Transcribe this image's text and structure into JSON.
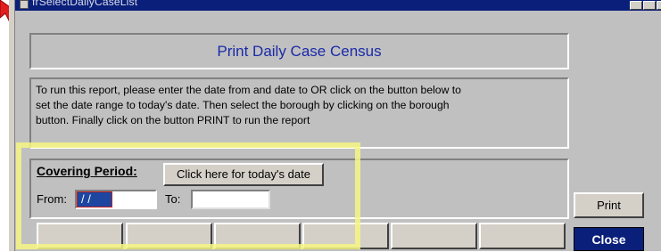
{
  "window": {
    "title": "frSelectDailyCaseList"
  },
  "header": {
    "title": "Print Daily Case Census"
  },
  "instructions": {
    "line1": "To run this report, please enter the date from and date to OR click on the button below to",
    "line2": "set the date range to today's date. Then select the borough by clicking on the borough",
    "line3": "button. Finally click on the button PRINT to run the report"
  },
  "period": {
    "label": "Covering Period:",
    "today_button": "Click here for today's date",
    "from_label": "From:",
    "from_value": " / /",
    "to_label": "To:",
    "to_value": ""
  },
  "boroughs": [
    "",
    "",
    "",
    "",
    "",
    ""
  ],
  "actions": {
    "print": "Print",
    "close": "Close"
  },
  "colors": {
    "title_text": "#1a2aa8",
    "titlebar": "#0a1f7a",
    "highlight": "#f6f682",
    "cursor": "#e02020"
  }
}
